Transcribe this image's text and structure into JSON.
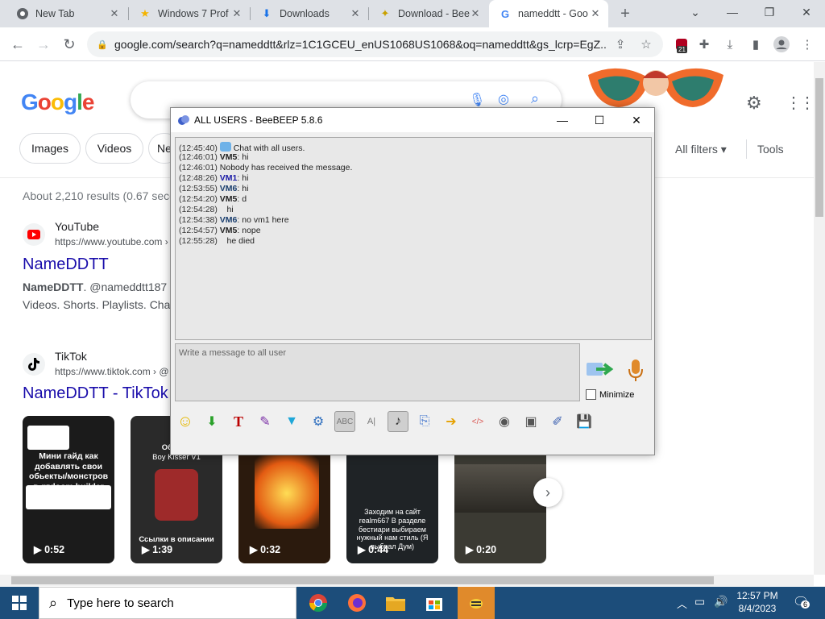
{
  "browser": {
    "tabs": [
      {
        "label": "New Tab",
        "icon": "chrome-icon"
      },
      {
        "label": "Windows 7 Prof",
        "icon": "star-icon"
      },
      {
        "label": "Downloads",
        "icon": "download-icon"
      },
      {
        "label": "Download - Bee",
        "icon": "beebeep-icon"
      },
      {
        "label": "nameddtt - Goo",
        "icon": "google-icon"
      }
    ],
    "new_tab_glyph": "+",
    "url": "google.com/search?q=nameddtt&rlz=1C1GCEU_enUS1068US1068&oq=nameddtt&gs_lcrp=EgZ...",
    "extension_badge": "21"
  },
  "google": {
    "logo": "Google",
    "chips": [
      "Images",
      "Videos",
      "Ne"
    ],
    "all_filters": "All filters",
    "tools": "Tools",
    "result_stats": "About 2,210 results (0.67 seco",
    "results": [
      {
        "site": "YouTube",
        "url": "https://www.youtube.com ›",
        "title": "NameDDTT",
        "snippet_bold": "NameDDTT",
        "snippet_rest": ". @nameddtt187",
        "snippet2": "Videos. Shorts. Playlists. Cha"
      },
      {
        "site": "TikTok",
        "url": "https://www.tiktok.com › @",
        "title": "NameDDTT - TikTok"
      }
    ],
    "videos": [
      {
        "duration": "0:52",
        "caption": "Мини гайд как добавлять свои обьекты/монстров в gzdoom builder"
      },
      {
        "duration": "1:39",
        "caption": "Ссылки в описании",
        "top": "Обновл",
        "top2": "Boy Kisser V1"
      },
      {
        "duration": "0:32",
        "caption": ""
      },
      {
        "duration": "0:44",
        "caption": "Заходим на сайт realm667 В разделе бестиари выбираем нужный нам стиль (Я выбрал Дум)"
      },
      {
        "duration": "0:20",
        "caption": ""
      }
    ]
  },
  "beebeep": {
    "title": "ALL USERS - BeeBEEP 5.8.6",
    "messages": [
      {
        "ts": "(12:45:40)",
        "user": "",
        "text": " Chat with all users.",
        "system": true
      },
      {
        "ts": "(12:46:01)",
        "user": "VM5",
        "text": ": hi"
      },
      {
        "ts": "(12:46:01)",
        "user": "",
        "text": " Nobody has received the message.",
        "system": true
      },
      {
        "ts": "(12:48:26)",
        "user": "VM1",
        "text": ": hi",
        "color": "#1a1aa6"
      },
      {
        "ts": "(12:53:55)",
        "user": "VM6",
        "text": ": hi",
        "color": "#1a3e6e"
      },
      {
        "ts": "(12:54:20)",
        "user": "VM5",
        "text": ": d"
      },
      {
        "ts": "(12:54:28)",
        "user": "",
        "text": "    hi"
      },
      {
        "ts": "(12:54:38)",
        "user": "VM6",
        "text": ": no vm1 here",
        "color": "#1a3e6e"
      },
      {
        "ts": "(12:54:57)",
        "user": "VM5",
        "text": ": nope"
      },
      {
        "ts": "(12:55:28)",
        "user": "",
        "text": "    he died"
      }
    ],
    "input_placeholder": "Write a message to all user",
    "minimize_label": "Minimize"
  },
  "taskbar": {
    "search_placeholder": "Type here to search",
    "time": "12:57 PM",
    "date": "8/4/2023",
    "notification_count": "6"
  }
}
